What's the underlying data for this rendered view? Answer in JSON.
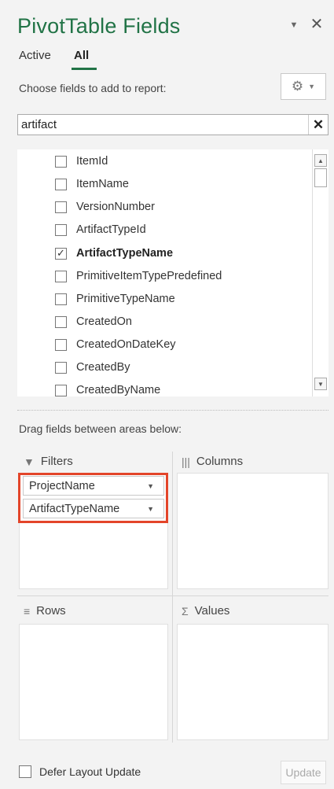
{
  "header": {
    "title": "PivotTable Fields",
    "dropdown_icon": "chevron-down-icon",
    "close_glyph": "✕"
  },
  "tabs": [
    {
      "label": "Active"
    },
    {
      "label": "All"
    }
  ],
  "choose_label": "Choose fields to add to report:",
  "search": {
    "value": "artifact",
    "clear_glyph": "✕"
  },
  "fields": [
    {
      "label": "ItemId",
      "checked": false
    },
    {
      "label": "ItemName",
      "checked": false
    },
    {
      "label": "VersionNumber",
      "checked": false
    },
    {
      "label": "ArtifactTypeId",
      "checked": false
    },
    {
      "label": "ArtifactTypeName",
      "checked": true
    },
    {
      "label": "PrimitiveItemTypePredefined",
      "checked": false
    },
    {
      "label": "PrimitiveTypeName",
      "checked": false
    },
    {
      "label": "CreatedOn",
      "checked": false
    },
    {
      "label": "CreatedOnDateKey",
      "checked": false
    },
    {
      "label": "CreatedBy",
      "checked": false
    },
    {
      "label": "CreatedByName",
      "checked": false
    }
  ],
  "drag_label": "Drag fields between areas below:",
  "areas": {
    "filters": {
      "label": "Filters",
      "items": [
        "ProjectName",
        "ArtifactTypeName"
      ]
    },
    "columns": {
      "label": "Columns"
    },
    "rows": {
      "label": "Rows"
    },
    "values": {
      "label": "Values"
    }
  },
  "footer": {
    "defer_label": "Defer Layout Update",
    "update_label": "Update"
  },
  "colors": {
    "accent": "#217346",
    "highlight": "#e3452a"
  }
}
